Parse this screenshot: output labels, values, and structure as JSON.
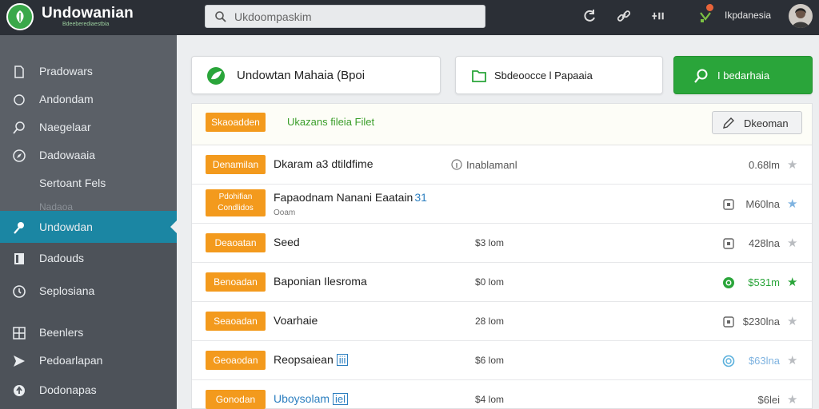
{
  "header": {
    "app_title": "Undowanian",
    "app_subtitle": "Bdeeberediaestbia",
    "search_placeholder": "Ukdoompaskim",
    "user_name": "Ikpdanesia",
    "icons": [
      "refresh-icon",
      "link-icon",
      "tools-icon",
      "badge-icon"
    ]
  },
  "sidebar": {
    "items": [
      {
        "label": "Pradowars",
        "icon": "file-icon"
      },
      {
        "label": "Andondam",
        "icon": "circle-icon"
      },
      {
        "label": "Naegelaar",
        "icon": "search-icon"
      },
      {
        "label": "Dadowaaia",
        "icon": "compass-icon"
      },
      {
        "label": "Sertoant Fels",
        "icon": ""
      },
      {
        "label": "Nadaoa",
        "icon": ""
      },
      {
        "label": "Undowdan",
        "icon": "key-icon"
      },
      {
        "label": "Dadouds",
        "icon": "document-icon"
      },
      {
        "label": "Seplosiana",
        "icon": "clock-icon"
      },
      {
        "label": "Beenlers",
        "icon": "grid-icon"
      },
      {
        "label": "Pedoarlapan",
        "icon": "send-icon"
      },
      {
        "label": "Dodonapas",
        "icon": "upload-icon"
      }
    ],
    "active_index": 6
  },
  "actions": {
    "card1_label": "Undowtan Mahaia  (Bpoi",
    "card2_label": "Sbdeoocce l Papaaia",
    "card3_label": "I bedarhaia"
  },
  "list": {
    "header_tag": "Skaoadden",
    "header_title": "Ukazans fileia Filet",
    "header_button": "Dkeoman",
    "rows": [
      {
        "tag": "Denamilan",
        "name": "Dkaram a3 dtildfime",
        "sub": "",
        "mid": "Inablamanl",
        "mid_style": "info",
        "icon": "info-icon",
        "size": "0.68lm",
        "star": "gray"
      },
      {
        "tag": "Pdohifian Condlidos",
        "name": "Fapaodnam Nanani Eaatain",
        "badge": "31",
        "sub": "Ooam",
        "mid": "",
        "icon": "square-icon",
        "size": "M60lna",
        "star": "blue"
      },
      {
        "tag": "Deaoatan",
        "name": "Seed",
        "sub": "",
        "mid": "$3 lom",
        "icon": "square-icon",
        "size": "428lna",
        "star": "gray"
      },
      {
        "tag": "Benoadan",
        "name": "Baponian Ilesroma",
        "sub": "",
        "mid": "$0 lom",
        "icon": "check-circle-icon",
        "size": "$531m",
        "star": "green"
      },
      {
        "tag": "Seaoadan",
        "name": "Voarhaie",
        "sub": "",
        "mid": "28 lom",
        "icon": "square-icon",
        "size": "$230lna",
        "star": "gray"
      },
      {
        "tag": "Geoaodan",
        "name": "Reopsaiean",
        "badge": "iii",
        "sub": "",
        "mid": "$6 lom",
        "icon": "circle-icon",
        "size": "$63lna",
        "star": "gray"
      },
      {
        "tag": "Gonodan",
        "name": "Uboysolam",
        "badge": "iel",
        "sub": "",
        "mid": "$4 lom",
        "icon": "",
        "size": "$6lei",
        "star": "gray"
      }
    ]
  },
  "colors": {
    "topbar": "#2b2f36",
    "sidebar": "#4d5259",
    "active": "#1b86a3",
    "accent_green": "#2aa53a",
    "tag_orange": "#f39a1d"
  }
}
